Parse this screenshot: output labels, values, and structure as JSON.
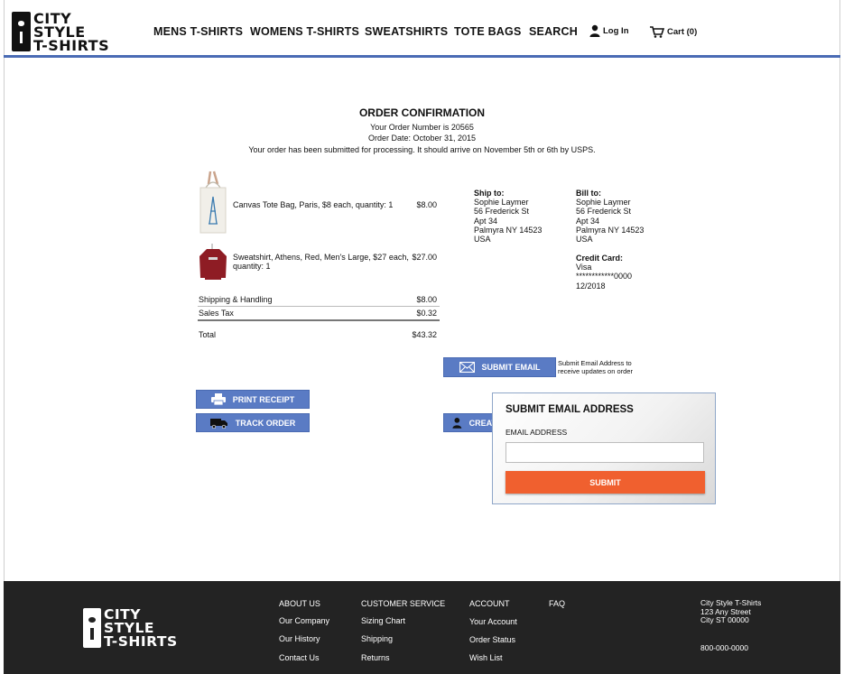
{
  "brand": {
    "logo_lines": [
      "CITY",
      "STYLE",
      "T-SHIRTS"
    ]
  },
  "nav": {
    "items": [
      "MENS T-SHIRTS",
      "WOMENS T-SHIRTS",
      "SWEATSHIRTS",
      "TOTE BAGS",
      "SEARCH"
    ],
    "login": "Log In",
    "cart": "Cart (0)"
  },
  "confirmation": {
    "title": "ORDER CONFIRMATION",
    "order_number": "Your Order Number is 20565",
    "order_date": "Order Date: October 31, 2015",
    "message": "Your order has been submitted for processing. It should arrive on November 5th or 6th by USPS."
  },
  "order": {
    "items": [
      {
        "description": "Canvas Tote Bag, Paris, $8 each, quantity: 1",
        "price": "$8.00",
        "thumb_icon": "tote-bag-icon"
      },
      {
        "description": "Sweatshirt, Athens, Red, Men's Large, $27 each, quantity: 1",
        "price": "$27.00",
        "thumb_icon": "sweatshirt-icon"
      }
    ],
    "shipping_label": "Shipping & Handling",
    "shipping_value": "$8.00",
    "tax_label": "Sales Tax",
    "tax_value": "$0.32",
    "total_label": "Total",
    "total_value": "$43.32"
  },
  "ship_to": {
    "heading": "Ship to:",
    "lines": [
      "Sophie Laymer",
      "56 Frederick St",
      "Apt 34",
      "Palmyra NY 14523",
      "USA"
    ]
  },
  "bill_to": {
    "heading": "Bill to:",
    "lines": [
      "Sophie Laymer",
      "56 Frederick St",
      "Apt 34",
      "Palmyra NY 14523",
      "USA"
    ]
  },
  "credit_card": {
    "heading": "Credit Card:",
    "lines": [
      "Visa",
      "************0000",
      "12/2018"
    ]
  },
  "actions": {
    "submit_email": "SUBMIT EMAIL",
    "submit_email_note": "Submit Email Address to receive updates on order",
    "print_receipt": "PRINT RECEIPT",
    "track_order": "TRACK ORDER",
    "create_account_partial": "CREAT"
  },
  "popup": {
    "title": "SUBMIT EMAIL ADDRESS",
    "field_label": "EMAIL ADDRESS",
    "field_value": "",
    "submit_label": "SUBMIT"
  },
  "footer": {
    "about": [
      "ABOUT US",
      "Our Company",
      "Our History",
      "Contact Us"
    ],
    "customer_service": [
      "CUSTOMER SERVICE",
      "Sizing Chart",
      "Shipping",
      "Returns"
    ],
    "account": [
      "ACCOUNT",
      "Your Account",
      "Order Status",
      "Wish List"
    ],
    "faq": "FAQ",
    "address": [
      "City Style T-Shirts",
      "123 Any Street",
      "City ST 00000"
    ],
    "phone": "800-000-0000"
  },
  "colors": {
    "accent_blue": "#5a7bc4",
    "header_rule": "#4a6bb4",
    "submit_orange": "#f0602f",
    "footer_bg": "#232323"
  }
}
